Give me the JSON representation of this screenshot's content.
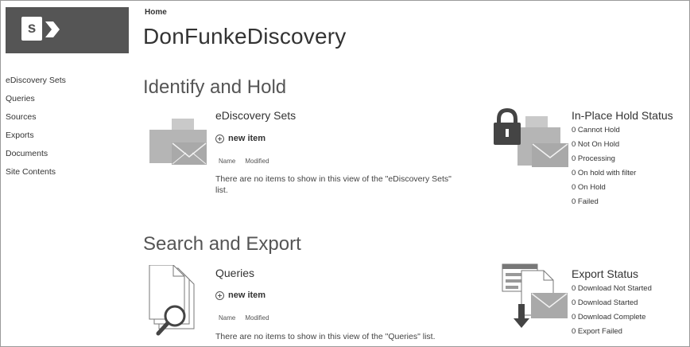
{
  "header": {
    "breadcrumb": "Home",
    "site_title": "DonFunkeDiscovery",
    "logo_letter": "s"
  },
  "nav": {
    "items": [
      {
        "label": "eDiscovery Sets"
      },
      {
        "label": "Queries"
      },
      {
        "label": "Sources"
      },
      {
        "label": "Exports"
      },
      {
        "label": "Documents"
      },
      {
        "label": "Site Contents"
      }
    ]
  },
  "identify": {
    "section_title": "Identify and Hold",
    "list_title": "eDiscovery Sets",
    "new_item": "new item",
    "col_name": "Name",
    "col_modified": "Modified",
    "empty_line1": "There are no items to show in this view of the \"eDiscovery Sets\"",
    "empty_line2": "list.",
    "status_title": "In-Place Hold Status",
    "status_lines": [
      "0 Cannot Hold",
      "0 Not On Hold",
      "0 Processing",
      "0 On hold with filter",
      "0 On Hold",
      "0 Failed"
    ]
  },
  "search": {
    "section_title": "Search and Export",
    "list_title": "Queries",
    "new_item": "new item",
    "col_name": "Name",
    "col_modified": "Modified",
    "empty_line1": "There are no items to show in this view of the \"Queries\" list.",
    "status_title": "Export Status",
    "status_lines": [
      "0 Download Not Started",
      "0 Download Started",
      "0 Download Complete",
      "0 Export Failed"
    ]
  },
  "colors": {
    "logo_bg": "#555555",
    "icon_gray": "#b5b5b5",
    "text": "#333333"
  }
}
